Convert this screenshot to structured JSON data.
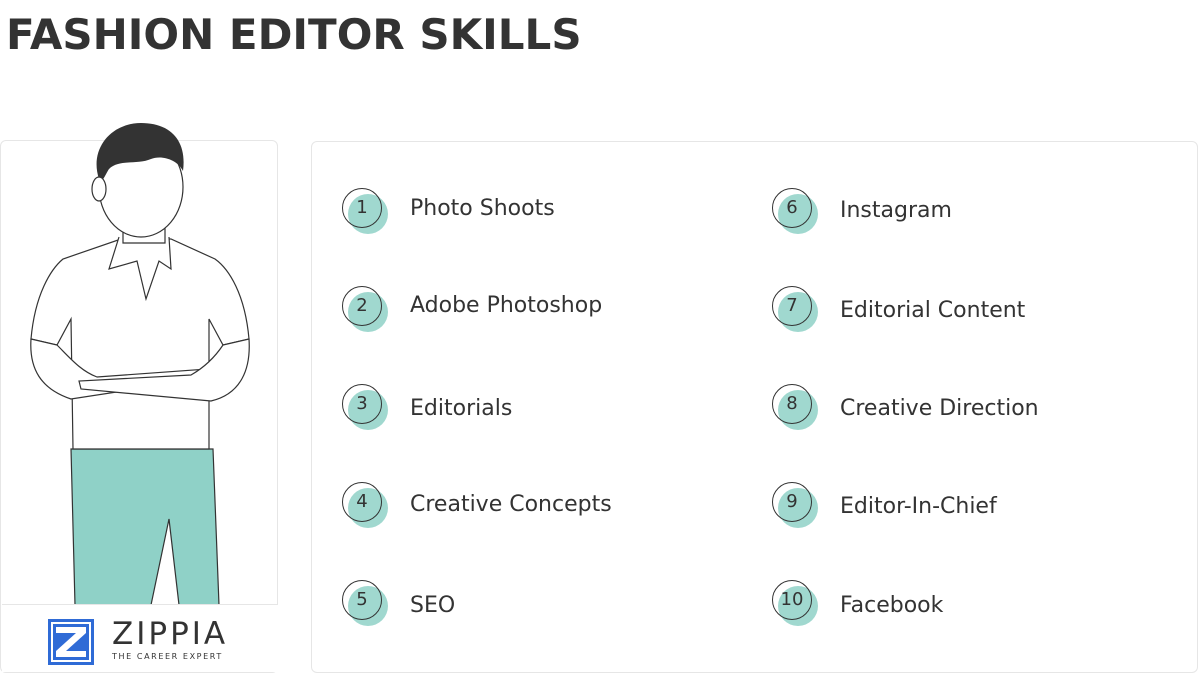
{
  "page": {
    "title": "FASHION EDITOR SKILLS"
  },
  "colors": {
    "accent": "#8fd1c7",
    "text": "#333333",
    "logo_blue": "#2f6bd6"
  },
  "skills": [
    {
      "number": "1",
      "label": "Photo Shoots"
    },
    {
      "number": "2",
      "label": "Adobe Photoshop"
    },
    {
      "number": "3",
      "label": "Editorials"
    },
    {
      "number": "4",
      "label": "Creative Concepts"
    },
    {
      "number": "5",
      "label": "SEO"
    },
    {
      "number": "6",
      "label": "Instagram"
    },
    {
      "number": "7",
      "label": "Editorial Content"
    },
    {
      "number": "8",
      "label": "Creative Direction"
    },
    {
      "number": "9",
      "label": "Editor-In-Chief"
    },
    {
      "number": "10",
      "label": "Facebook"
    }
  ],
  "brand": {
    "name": "ZIPPIA",
    "tagline": "THE CAREER EXPERT",
    "logo_icon": "zippia-logo-icon"
  },
  "illustration": {
    "icon": "person-illustration-icon"
  }
}
